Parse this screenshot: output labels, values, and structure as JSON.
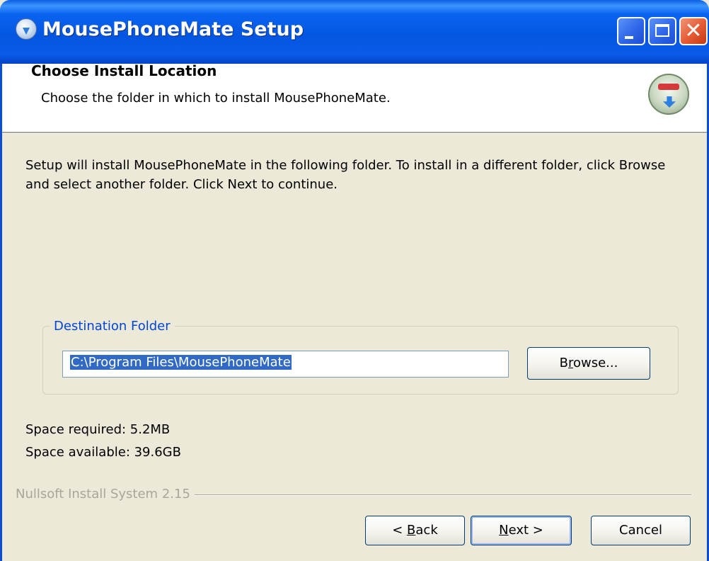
{
  "window": {
    "title": "MousePhoneMate Setup",
    "icons": {
      "app": "setup-icon",
      "minimize": "minimize-icon",
      "maximize": "maximize-icon",
      "close": "close-icon"
    }
  },
  "header": {
    "title": "Choose Install Location",
    "subtitle": "Choose the folder in which to install MousePhoneMate.",
    "logo": "nsis-installer-icon"
  },
  "body": {
    "intro": "Setup will install MousePhoneMate in the following folder. To install in a different folder, click Browse and select another folder. Click Next to continue.",
    "destination": {
      "legend": "Destination Folder",
      "path": "C:\\Program Files\\MousePhoneMate",
      "browse_pre": "B",
      "browse_ul": "r",
      "browse_post": "owse..."
    },
    "space_required": "Space required: 5.2MB",
    "space_available": "Space available: 39.6GB"
  },
  "footer": {
    "branding": "Nullsoft Install System 2.15",
    "back_pre": "< ",
    "back_ul": "B",
    "back_post": "ack",
    "next_ul": "N",
    "next_post": "ext >",
    "cancel": "Cancel"
  }
}
